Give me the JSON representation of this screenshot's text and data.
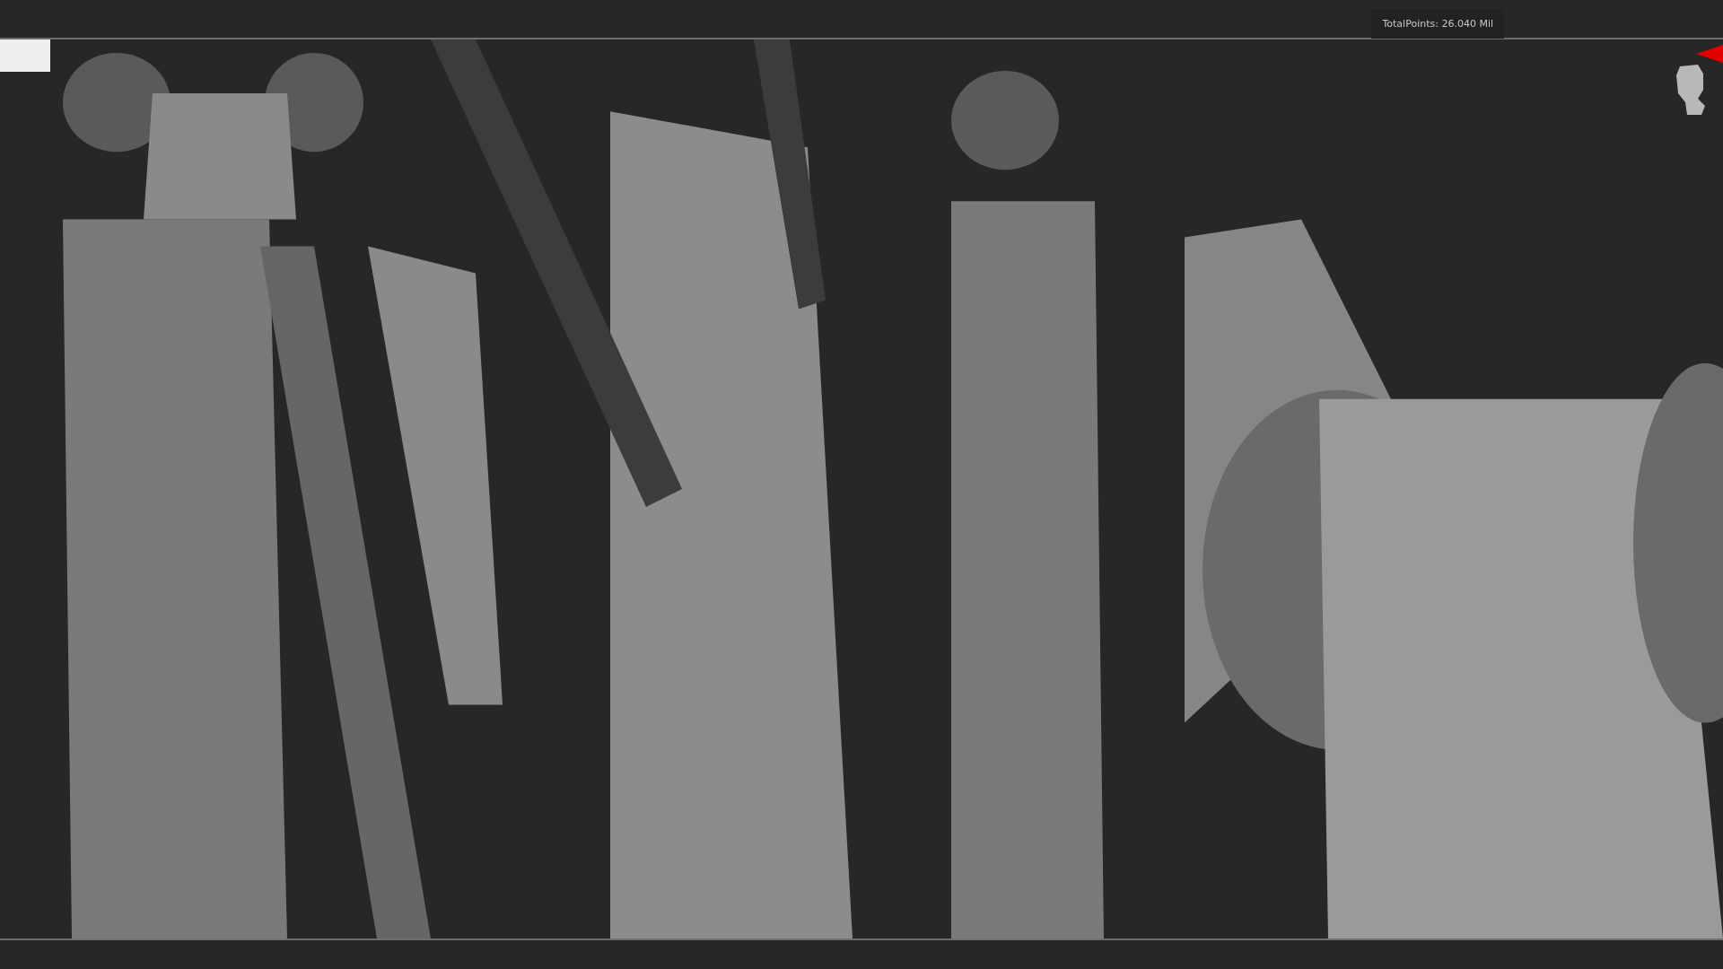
{
  "viewport": {
    "total_points": "TotalPoints: 26.040 Mil"
  }
}
